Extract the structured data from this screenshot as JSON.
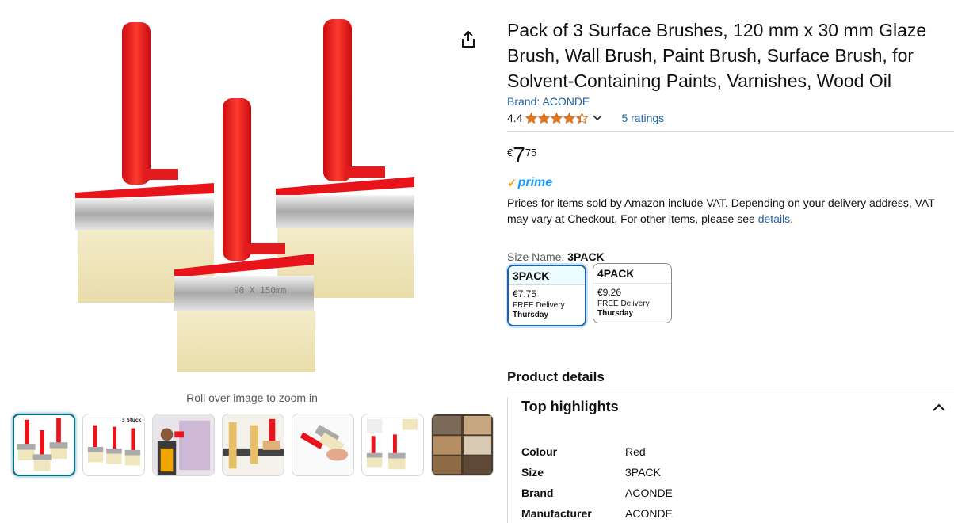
{
  "product": {
    "title": "Pack of 3 Surface Brushes, 120 mm x 30 mm Glaze Brush, Wall Brush, Paint Brush, Surface Brush, for Solvent-Containing Paints, Varnishes, Wood Oil",
    "brand_link": "Brand: ACONDE",
    "rating_value": "4.4",
    "rating_stars": 4.4,
    "ratings_count": "5 ratings",
    "price_symbol": "€",
    "price_whole": "7",
    "price_fraction": "75",
    "prime_label": "prime",
    "vat_text": "Prices for items sold by Amazon include VAT. Depending on your delivery address, VAT may vary at Checkout. For other items, please see ",
    "vat_link": "details",
    "vat_end": "."
  },
  "gallery": {
    "zoom_hint": "Roll over image to zoom in",
    "thumb_badge": "3 Stück",
    "main_brush_text": "90 X 150mm"
  },
  "size": {
    "label": "Size Name: ",
    "selected_name": "3PACK",
    "options": [
      {
        "name": "3PACK",
        "price": "€7.75",
        "delivery": "FREE Delivery",
        "day": "Thursday"
      },
      {
        "name": "4PACK",
        "price": "€9.26",
        "delivery": "FREE Delivery",
        "day": "Thursday"
      }
    ]
  },
  "details": {
    "section_title": "Product details",
    "highlights_title": "Top highlights",
    "rows": [
      {
        "key": "Colour",
        "value": "Red"
      },
      {
        "key": "Size",
        "value": "3PACK"
      },
      {
        "key": "Brand",
        "value": "ACONDE"
      },
      {
        "key": "Manufacturer",
        "value": "ACONDE"
      }
    ]
  },
  "colors": {
    "link": "#2162a1",
    "star": "#de7921",
    "prime": "#1399ff",
    "brush_red": "#e8141c",
    "selected_border": "#2162a1"
  },
  "icons": [
    "share-icon",
    "star-icon",
    "chevron-down-icon",
    "chevron-up-icon",
    "prime-check-icon"
  ]
}
